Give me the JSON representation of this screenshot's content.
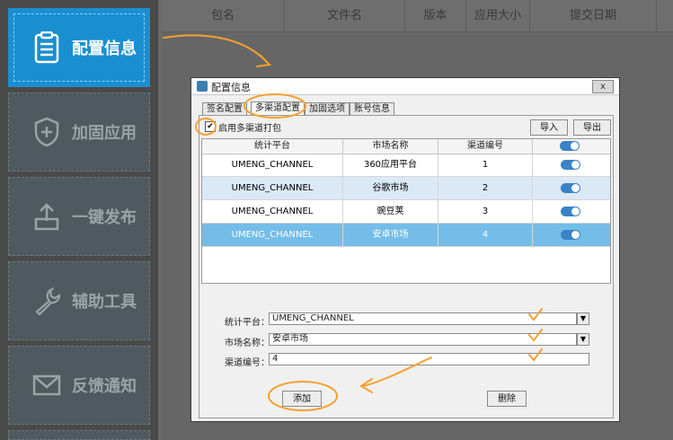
{
  "sidebar": {
    "items": [
      {
        "label": "配置信息",
        "icon": "clipboard-icon",
        "active": true
      },
      {
        "label": "加固应用",
        "icon": "shield-plus-icon",
        "active": false
      },
      {
        "label": "一键发布",
        "icon": "upload-tray-icon",
        "active": false
      },
      {
        "label": "辅助工具",
        "icon": "wrench-icon",
        "active": false
      },
      {
        "label": "反馈通知",
        "icon": "envelope-icon",
        "active": false
      }
    ]
  },
  "grid": {
    "columns": [
      "包名",
      "文件名",
      "版本",
      "应用大小",
      "提交日期"
    ]
  },
  "dialog": {
    "title": "配置信息",
    "close_label": "x",
    "tabs": [
      "签名配置",
      "多渠道配置",
      "加固选项",
      "账号信息"
    ],
    "active_tab": "多渠道配置",
    "enable_label": "启用多渠道打包",
    "enable_checked": true,
    "check_mark": "✔",
    "import_label": "导入",
    "export_label": "导出",
    "table": {
      "headers": [
        "统计平台",
        "市场名称",
        "渠道编号"
      ],
      "rows": [
        {
          "platform": "UMENG_CHANNEL",
          "market": "360应用平台",
          "channel": "1",
          "enabled": true
        },
        {
          "platform": "UMENG_CHANNEL",
          "market": "谷歌市场",
          "channel": "2",
          "enabled": true
        },
        {
          "platform": "UMENG_CHANNEL",
          "market": "豌豆荚",
          "channel": "3",
          "enabled": true
        },
        {
          "platform": "UMENG_CHANNEL",
          "market": "安卓市场",
          "channel": "4",
          "enabled": true
        }
      ]
    },
    "form": {
      "platform_label": "统计平台：",
      "platform_value": "UMENG_CHANNEL",
      "market_label": "市场名称：",
      "market_value": "安卓市场",
      "channel_label": "渠道编号：",
      "channel_value": "4",
      "dropdown_arrow": "▼"
    },
    "add_label": "添加",
    "delete_label": "删除"
  },
  "colors": {
    "accent": "#1a8fd0",
    "annotation": "#f5a030",
    "selected_row": "#74bde8",
    "toggle": "#3a82c8"
  }
}
